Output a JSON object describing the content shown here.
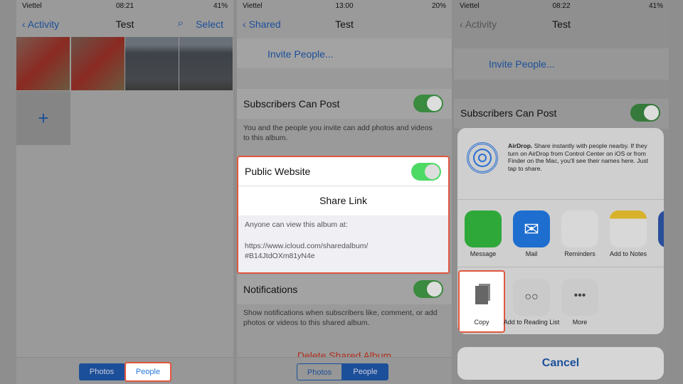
{
  "panel1": {
    "status": {
      "carrier": "Viettel",
      "time": "08:21",
      "battery": "41%"
    },
    "nav": {
      "back": "Activity",
      "title": "Test",
      "select": "Select"
    },
    "add": "+",
    "tabs": [
      "Photos",
      "People"
    ]
  },
  "panel2": {
    "status": {
      "carrier": "Viettel",
      "time": "13:00",
      "battery": "20%"
    },
    "nav": {
      "back": "Shared",
      "title": "Test"
    },
    "invite": "Invite People...",
    "subscribers": "Subscribers Can Post",
    "subscribers_note": "You and the people you invite can add photos and videos to this album.",
    "public_website": "Public Website",
    "share_link": "Share Link",
    "anyone": "Anyone can view this album at:",
    "url1": "https://www.icloud.com/sharedalbum/",
    "url2": "#B14JtdOXm81yN4e",
    "notifications": "Notifications",
    "notifications_note": "Show notifications when subscribers like, comment, or add photos or videos to this shared album.",
    "delete": "Delete Shared Album",
    "tabs": [
      "Photos",
      "People"
    ]
  },
  "panel3": {
    "status": {
      "carrier": "Viettel",
      "time": "08:22",
      "battery": "41%"
    },
    "nav": {
      "back": "Activity",
      "title": "Test"
    },
    "invite": "Invite People...",
    "subscribers": "Subscribers Can Post",
    "airdrop_title": "AirDrop.",
    "airdrop_text": " Share instantly with people nearby. If they turn on AirDrop from Control Center on iOS or from Finder on the Mac, you'll see their names here. Just tap to share.",
    "apps": [
      "Message",
      "Mail",
      "Reminders",
      "Add to Notes"
    ],
    "actions": [
      "Copy",
      "Add to Reading List",
      "More"
    ],
    "cancel": "Cancel"
  },
  "colors": {
    "accent": "#1c4f99",
    "highlight": "#e0573f",
    "toggle": "#3da24a",
    "delete": "#b03020"
  }
}
